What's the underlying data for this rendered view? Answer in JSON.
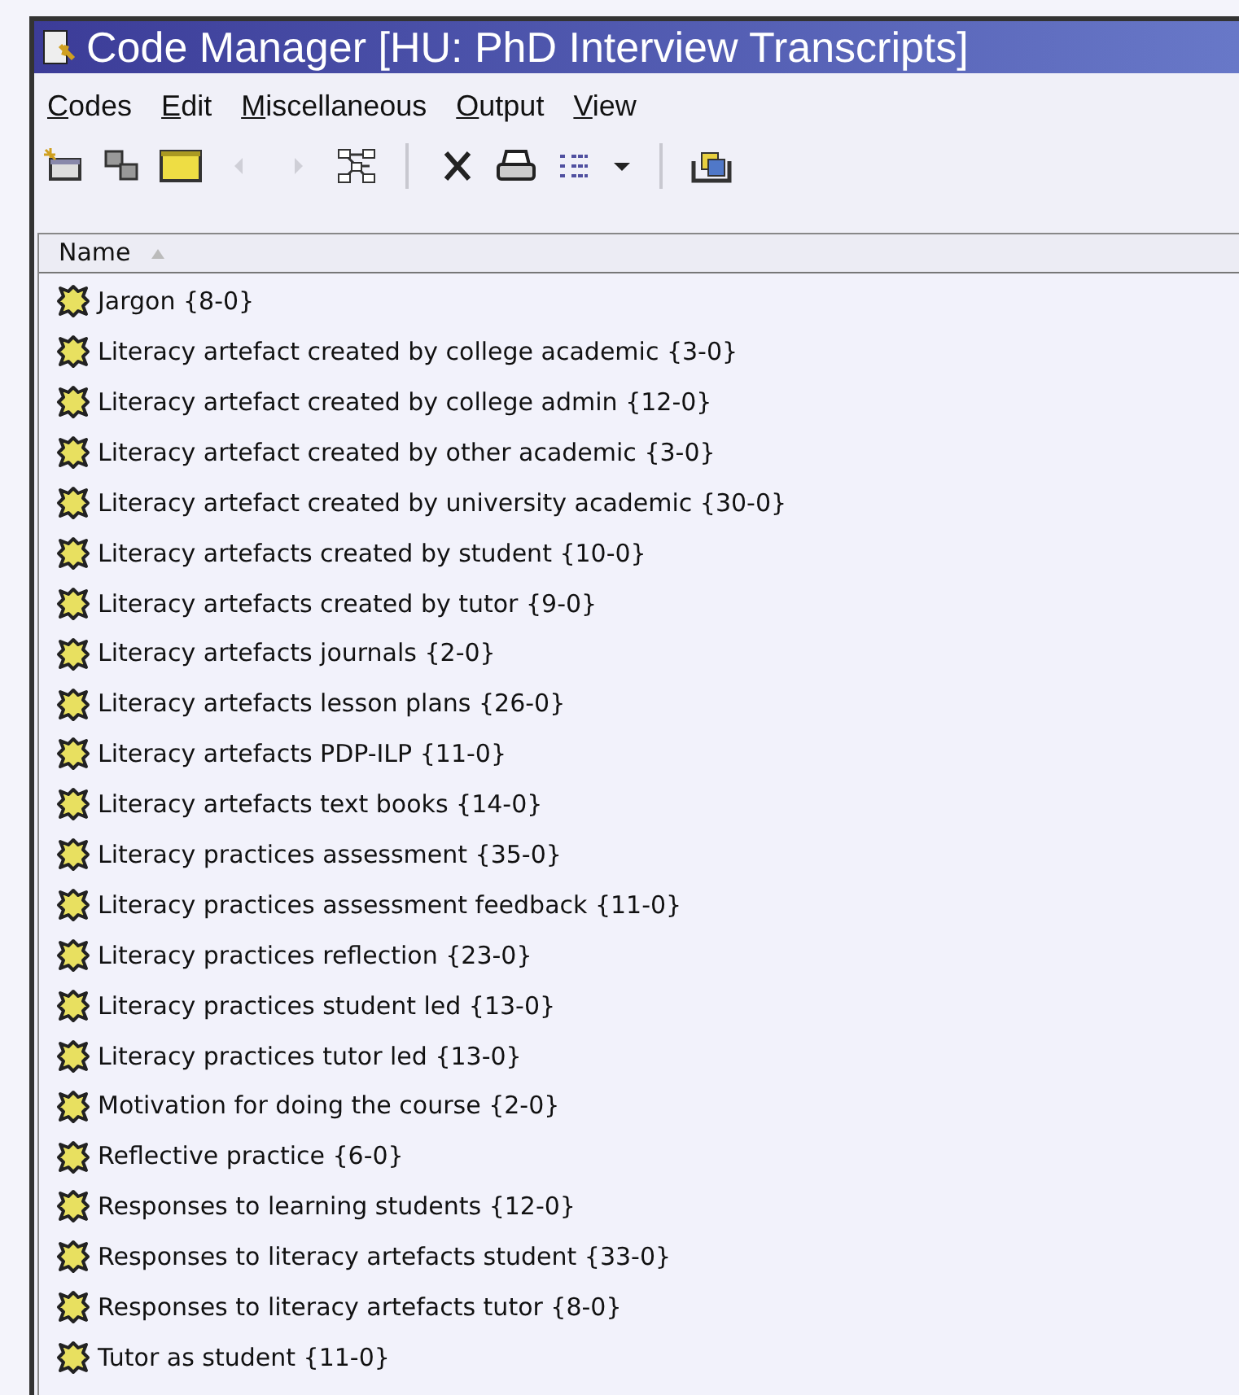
{
  "window": {
    "title": "Code Manager [HU: PhD Interview Transcripts]"
  },
  "menu": [
    "Codes",
    "Edit",
    "Miscellaneous",
    "Output",
    "View"
  ],
  "toolbar": [
    {
      "kind": "new",
      "disabled": false
    },
    {
      "kind": "link",
      "disabled": false
    },
    {
      "kind": "panel",
      "disabled": false
    },
    {
      "kind": "back",
      "disabled": true
    },
    {
      "kind": "forward",
      "disabled": true
    },
    {
      "kind": "network",
      "disabled": false
    },
    {
      "kind": "separator",
      "disabled": false
    },
    {
      "kind": "delete",
      "disabled": false
    },
    {
      "kind": "print",
      "disabled": false
    },
    {
      "kind": "list",
      "disabled": false
    },
    {
      "kind": "caret",
      "disabled": false
    },
    {
      "kind": "separator",
      "disabled": false
    },
    {
      "kind": "stack",
      "disabled": false
    }
  ],
  "table": {
    "columns": [
      {
        "label": "Name",
        "sorted": true
      }
    ],
    "rows": [
      "Jargon {8-0}",
      "Literacy artefact created by college academic {3-0}",
      "Literacy artefact created by college admin {12-0}",
      "Literacy artefact created by other academic {3-0}",
      "Literacy artefact created by university academic {30-0}",
      "Literacy artefacts created by student {10-0}",
      "Literacy artefacts created by tutor {9-0}",
      "Literacy artefacts journals {2-0}",
      "Literacy artefacts lesson plans {26-0}",
      "Literacy artefacts PDP-ILP {11-0}",
      "Literacy artefacts text books {14-0}",
      "Literacy practices assessment {35-0}",
      "Literacy practices assessment feedback {11-0}",
      "Literacy practices reflection {23-0}",
      "Literacy practices student led {13-0}",
      "Literacy practices tutor led {13-0}",
      "Motivation for doing the course {2-0}",
      "Reflective practice {6-0}",
      "Responses to learning students {12-0}",
      "Responses to literacy artefacts student {33-0}",
      "Responses to literacy artefacts tutor {8-0}",
      "Tutor as student {11-0}"
    ]
  }
}
